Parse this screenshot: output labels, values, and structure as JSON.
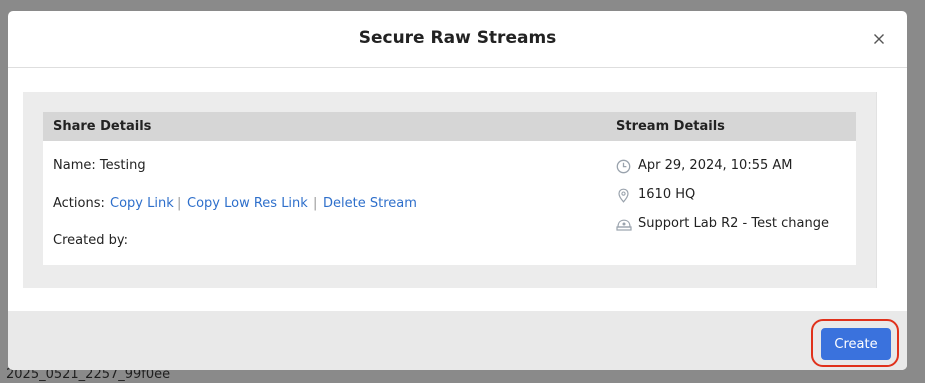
{
  "footer_id": "2025_0521_2257_99f0ee",
  "modal": {
    "title": "Secure Raw Streams",
    "close_icon": "close-icon"
  },
  "share_details": {
    "heading": "Share Details",
    "name_label": "Name: Testing",
    "actions_label": "Actions:",
    "actions": [
      "Copy Link",
      "Copy Low Res Link",
      "Delete Stream"
    ],
    "separator": "|",
    "created_by_label": "Created by:"
  },
  "stream_details": {
    "heading": "Stream Details",
    "datetime": "Apr 29, 2024, 10:55 AM",
    "location": "1610 HQ",
    "camera": "Support Lab R2 - Test change",
    "icons": [
      "clock-icon",
      "location-pin-icon",
      "camera-icon"
    ]
  },
  "footer": {
    "create_label": "Create"
  },
  "colors": {
    "accent": "#3a72dd",
    "link": "#2e6fcb",
    "highlight": "#e0311b"
  }
}
